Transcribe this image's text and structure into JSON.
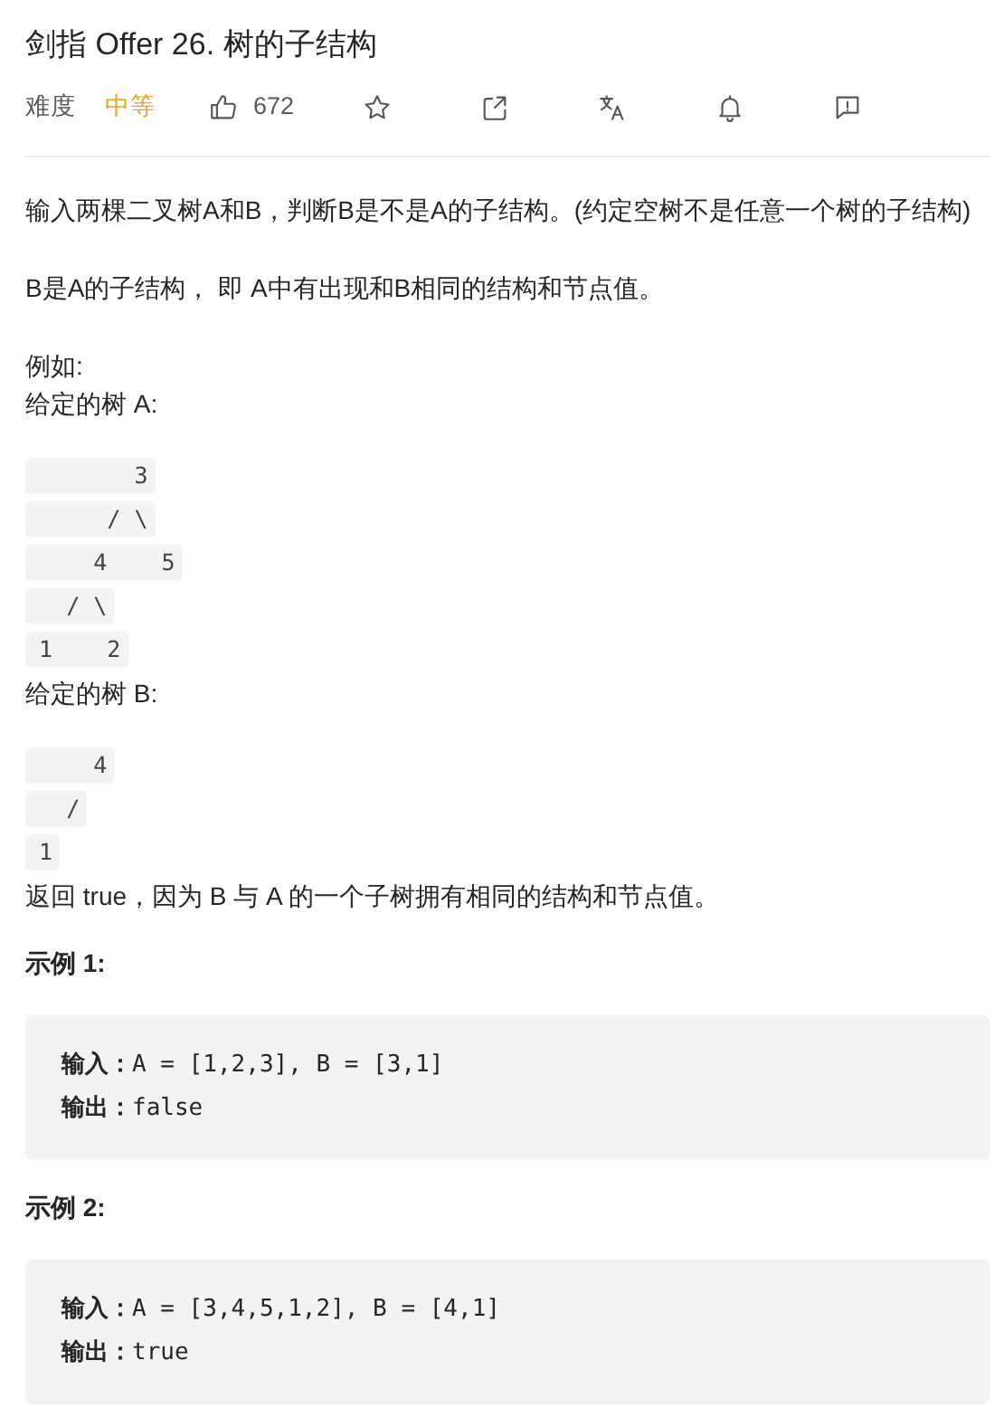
{
  "title": "剑指 Offer 26. 树的子结构",
  "meta": {
    "difficulty_label": "难度",
    "difficulty": "中等",
    "likes": "672"
  },
  "actions": [
    {
      "kind": "star"
    },
    {
      "kind": "share"
    },
    {
      "kind": "translate"
    },
    {
      "kind": "bell"
    },
    {
      "kind": "feedback"
    }
  ],
  "content": [
    {
      "kind": "para",
      "text": "输入两棵二叉树A和B，判断B是不是A的子结构。(约定空树不是任意一个树的子结构)"
    },
    {
      "kind": "para",
      "text": "B是A的子结构， 即 A中有出现和B相同的结构和节点值。"
    },
    {
      "kind": "line",
      "text": "例如:"
    },
    {
      "kind": "line",
      "text": "给定的树 A:"
    },
    {
      "kind": "tree",
      "lines": [
        "        3",
        "      / \\",
        "     4    5",
        "   / \\",
        " 1    2"
      ]
    },
    {
      "kind": "line",
      "text": "给定的树 B:"
    },
    {
      "kind": "tree",
      "lines": [
        "     4",
        "   /",
        " 1"
      ]
    },
    {
      "kind": "line",
      "text": "返回 true，因为 B 与 A 的一个子树拥有相同的结构和节点值。"
    },
    {
      "kind": "heading",
      "text": "示例 1:"
    },
    {
      "kind": "example",
      "lines": [
        "**输入：**A = [1,2,3], B = [3,1]",
        "**输出：**false"
      ]
    },
    {
      "kind": "heading",
      "text": "示例 2:"
    },
    {
      "kind": "example",
      "lines": [
        "**输入：**A = [3,4,5,1,2], B = [4,1]",
        "**输出：**true"
      ]
    }
  ]
}
